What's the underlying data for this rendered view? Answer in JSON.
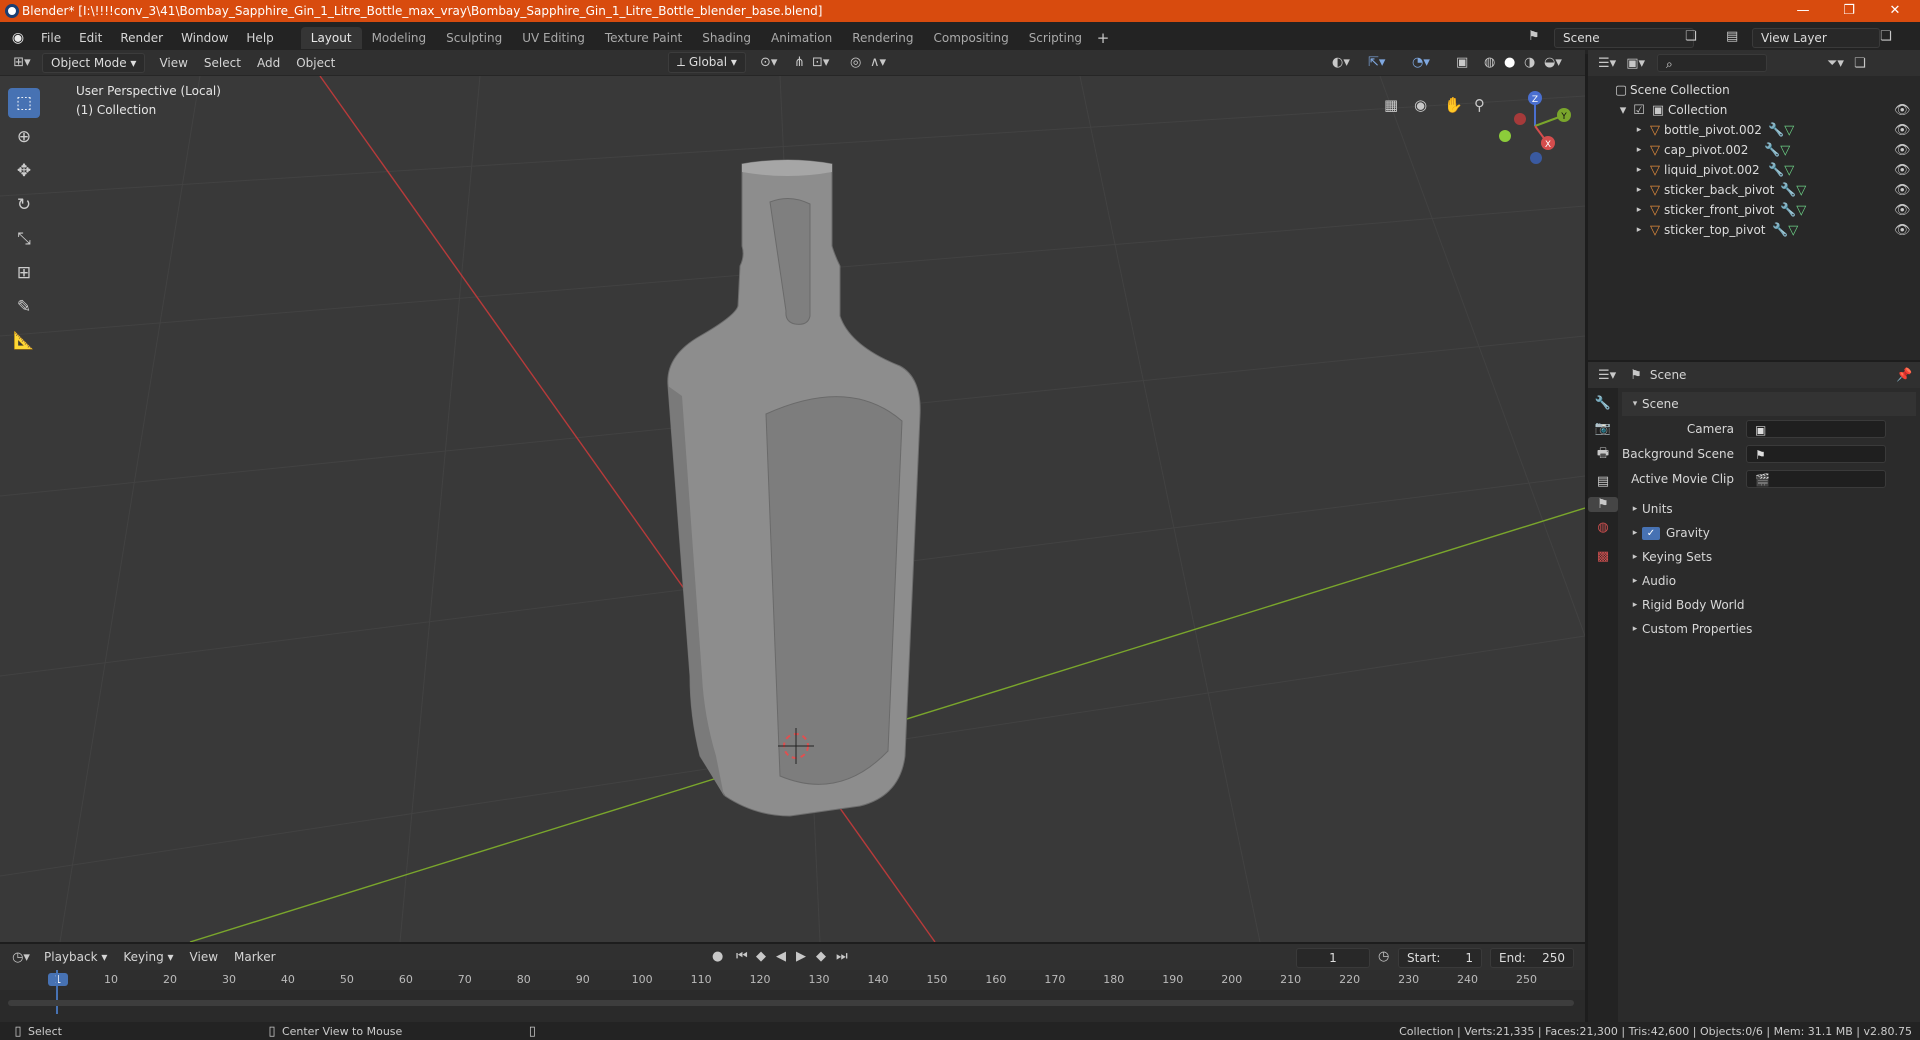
{
  "window": {
    "title": "Blender* [I:\\!!!!conv_3\\41\\Bombay_Sapphire_Gin_1_Litre_Bottle_max_vray\\Bombay_Sapphire_Gin_1_Litre_Bottle_blender_base.blend]",
    "minimize": "—",
    "maximize": "❐",
    "close": "✕"
  },
  "menu": [
    "File",
    "Edit",
    "Render",
    "Window",
    "Help"
  ],
  "workspaces": [
    "Layout",
    "Modeling",
    "Sculpting",
    "UV Editing",
    "Texture Paint",
    "Shading",
    "Animation",
    "Rendering",
    "Compositing",
    "Scripting"
  ],
  "active_workspace": "Layout",
  "scene_field": "Scene",
  "view_layer_field": "View Layer",
  "viewport_header": {
    "mode": "Object Mode",
    "menus": [
      "View",
      "Select",
      "Add",
      "Object"
    ],
    "orientation": "Global"
  },
  "viewport": {
    "overlay_line1": "User Perspective (Local)",
    "overlay_line2": "(1) Collection"
  },
  "gizmo": {
    "x": "X",
    "y": "Y",
    "z": "Z"
  },
  "outliner": {
    "root": "Scene Collection",
    "collection": "Collection",
    "objects": [
      "bottle_pivot.002",
      "cap_pivot.002",
      "liquid_pivot.002",
      "sticker_back_pivot",
      "sticker_front_pivot",
      "sticker_top_pivot"
    ]
  },
  "properties": {
    "context": "Scene",
    "panel": "Scene",
    "fields": [
      {
        "label": "Camera",
        "value": ""
      },
      {
        "label": "Background Scene",
        "value": ""
      },
      {
        "label": "Active Movie Clip",
        "value": ""
      }
    ],
    "sections": [
      "Units",
      "Gravity",
      "Keying Sets",
      "Audio",
      "Rigid Body World",
      "Custom Properties"
    ],
    "gravity_checked": true
  },
  "timeline": {
    "menus": [
      "Playback",
      "Keying",
      "View",
      "Marker"
    ],
    "current_frame": "1",
    "start_label": "Start:",
    "start": "1",
    "end_label": "End:",
    "end": "250",
    "ticks": [
      "1",
      "10",
      "20",
      "30",
      "40",
      "50",
      "60",
      "70",
      "80",
      "90",
      "100",
      "110",
      "120",
      "130",
      "140",
      "150",
      "160",
      "170",
      "180",
      "190",
      "200",
      "210",
      "220",
      "230",
      "240",
      "250"
    ]
  },
  "status": {
    "left": "Select",
    "middle": "Center View to Mouse",
    "right": "Collection | Verts:21,335 | Faces:21,300 | Tris:42,600 | Objects:0/6 | Mem: 31.1 MB | v2.80.75"
  },
  "colors": {
    "titlebar": "#d84b0e",
    "accent": "#4772b3",
    "viewport": "#393939",
    "x_axis": "#b73a3a",
    "y_axis": "#7aa62c"
  },
  "icons": [
    "blender-logo-icon",
    "select-box-icon",
    "cursor-icon",
    "move-icon",
    "rotate-icon",
    "scale-icon",
    "transform-icon",
    "annotate-icon",
    "measure-icon",
    "eye-icon",
    "mesh-icon",
    "modifier-icon",
    "camera-icon",
    "hand-icon",
    "zoom-icon"
  ]
}
